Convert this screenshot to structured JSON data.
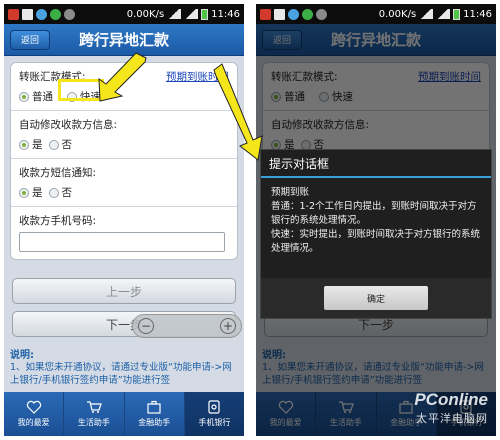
{
  "status_bar": {
    "speed": "0.00K/s",
    "time": "11:46"
  },
  "nav": {
    "back_label": "返回",
    "title": "跨行异地汇款"
  },
  "form": {
    "mode_label": "转账汇款模式:",
    "arrival_time_link": "预期到账时间",
    "mode_options": [
      "普通",
      "快速"
    ],
    "modify_label": "自动修改收款方信息:",
    "modify_options": [
      "是",
      "否"
    ],
    "sms_label": "收款方短信通知:",
    "sms_options": [
      "是",
      "否"
    ],
    "phone_label": "收款方手机号码:"
  },
  "buttons": {
    "prev": "上一步",
    "next": "下一步"
  },
  "notice": {
    "title": "说明:",
    "line1": "1、如果您未开通协议，请通过专业版“功能申请->网上银行/手机银行签约申请”功能进行签"
  },
  "tabs": [
    "我的最爱",
    "生活助手",
    "金融助手",
    "手机银行"
  ],
  "dialog": {
    "title": "提示对话框",
    "heading": "预期到账",
    "normal": "普通：1-2个工作日内提出，到账时间取决于对方银行的系统处理情况。",
    "fast": "快速：实时提出，到账时间取决于对方银行的系统处理情况。",
    "ok_label": "确定"
  },
  "watermark": {
    "brand": "PConline",
    "sub": "太平洋电脑网"
  },
  "colors": {
    "nav_blue": "#1b5aa6",
    "highlight_yellow": "#f4e61b",
    "link_blue": "#1e47b8"
  }
}
